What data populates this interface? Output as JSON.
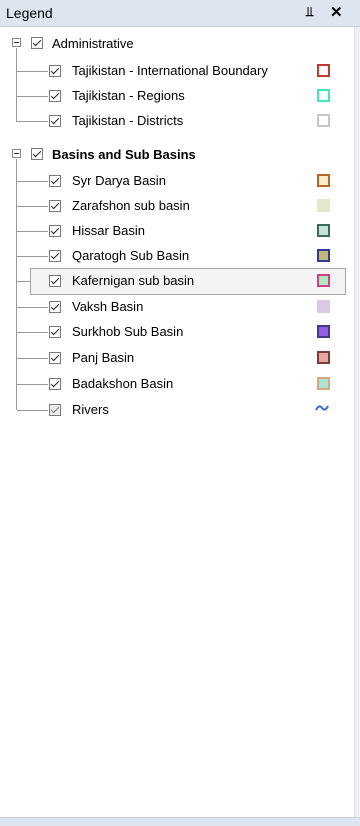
{
  "panel": {
    "title": "Legend"
  },
  "groups": [
    {
      "label": "Administrative",
      "items": [
        {
          "label": "Tajikistan - International Boundary",
          "swatch_border": "#c0392b",
          "swatch_fill": "#ffffff"
        },
        {
          "label": "Tajikistan - Regions",
          "swatch_border": "#3de8c8",
          "swatch_fill": "#ffffff"
        },
        {
          "label": "Tajikistan - Districts",
          "swatch_border": "#c8c8c8",
          "swatch_fill": "#ffffff"
        }
      ]
    },
    {
      "label": "Basins and Sub Basins",
      "items": [
        {
          "label": "Syr Darya Basin",
          "swatch_border": "#c0651f",
          "swatch_fill": "#f6eed2"
        },
        {
          "label": "Zarafshon sub basin",
          "swatch_border": "#e5e8c8",
          "swatch_fill": "#e5e8c8"
        },
        {
          "label": "Hissar Basin",
          "swatch_border": "#3a6a5c",
          "swatch_fill": "#c8e2d6"
        },
        {
          "label": "Qaratogh Sub Basin",
          "swatch_border": "#2c3c9c",
          "swatch_fill": "#c4b86c"
        },
        {
          "label": "Kafernigan sub basin",
          "swatch_border": "#d83c8c",
          "swatch_fill": "#a8ecbc"
        },
        {
          "label": "Vaksh Basin",
          "swatch_border": "#dcc8e6",
          "swatch_fill": "#dcc8e6"
        },
        {
          "label": "Surkhob Sub Basin",
          "swatch_border": "#3c3c8c",
          "swatch_fill": "#9a5ce8"
        },
        {
          "label": "Panj Basin",
          "swatch_border": "#7c3c3c",
          "swatch_fill": "#e8a8a0"
        },
        {
          "label": "Badakshon Basin",
          "swatch_border": "#d8a878",
          "swatch_fill": "#a6e6d6"
        },
        {
          "label": "Rivers",
          "swatch_icon": "wavy-line-icon",
          "swatch_color": "#3c6ce0"
        }
      ]
    }
  ]
}
